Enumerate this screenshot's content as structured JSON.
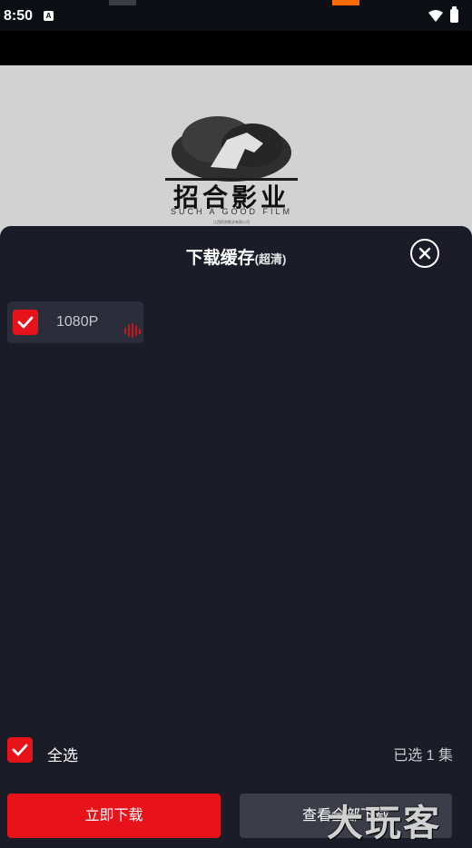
{
  "status_bar": {
    "time": "8:50",
    "notification_badge": "A"
  },
  "video": {
    "logo_title": "招合影业",
    "logo_subtitle": "SUCH A GOOD FILM",
    "logo_tiny": "江西招合影业有限公司"
  },
  "sheet": {
    "title": "下载缓存",
    "title_sub": "(超清)",
    "quality_option": {
      "label": "1080P",
      "checked": true
    },
    "select_all_label": "全选",
    "selected_count": "已选 1 集",
    "download_now_label": "立即下载",
    "view_all_downloads_label": "查看全部下载"
  },
  "watermark": "大玩客",
  "colors": {
    "accent": "#e8121a",
    "sheet_background": "#1a1c27",
    "secondary_button": "#3b3e48"
  },
  "icons": [
    "wifi-icon",
    "battery-icon",
    "close-icon",
    "checkmark-icon",
    "soundwave-icon"
  ]
}
